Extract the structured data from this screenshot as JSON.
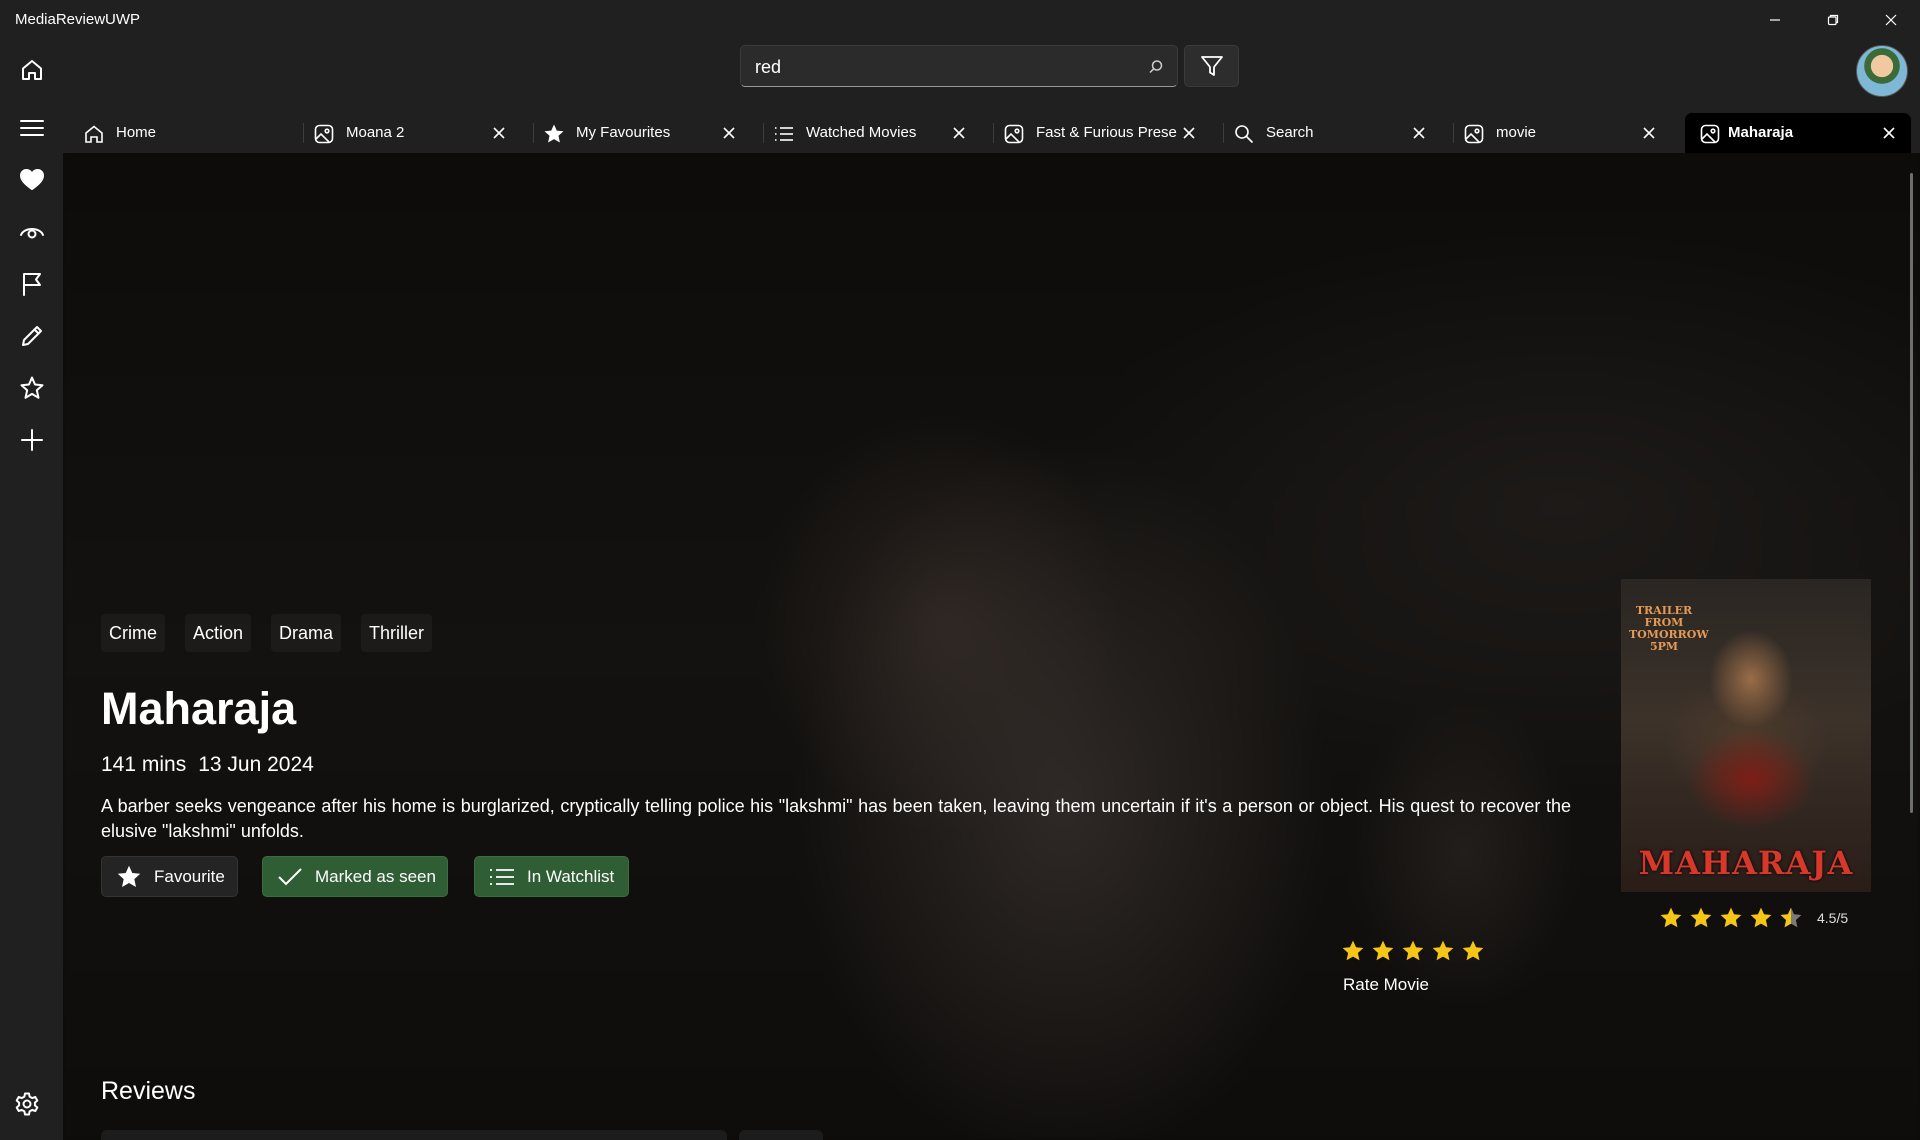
{
  "app": {
    "title": "MediaReviewUWP"
  },
  "window_controls": {
    "minimize_icon": "minimize-icon",
    "restore_icon": "restore-icon",
    "close_icon": "close-icon"
  },
  "search": {
    "value": "red",
    "placeholder": ""
  },
  "sidebar": {
    "items": [
      {
        "icon": "home-icon"
      },
      {
        "icon": "hamburger-menu-icon"
      },
      {
        "icon": "heart-icon"
      },
      {
        "icon": "eye-icon"
      },
      {
        "icon": "flag-icon"
      },
      {
        "icon": "pencil-icon"
      },
      {
        "icon": "star-outline-icon"
      },
      {
        "icon": "plus-icon"
      }
    ],
    "settings_icon": "gear-icon"
  },
  "tabs": [
    {
      "label": "Home",
      "icon": "home-icon",
      "closable": false
    },
    {
      "label": "Moana 2",
      "icon": "image-icon",
      "closable": true
    },
    {
      "label": "My Favourites",
      "icon": "star-icon",
      "closable": true
    },
    {
      "label": "Watched Movies",
      "icon": "list-icon",
      "closable": true
    },
    {
      "label": "Fast & Furious Prese",
      "icon": "image-icon",
      "closable": true
    },
    {
      "label": "Search",
      "icon": "search-icon",
      "closable": true
    },
    {
      "label": "movie",
      "icon": "image-icon",
      "closable": true
    },
    {
      "label": "Maharaja",
      "icon": "image-icon",
      "closable": true,
      "active": true
    }
  ],
  "movie": {
    "genres": [
      "Crime",
      "Action",
      "Drama",
      "Thriller"
    ],
    "title": "Maharaja",
    "runtime": "141 mins",
    "release_date": "13 Jun 2024",
    "overview": "A barber seeks vengeance after his home is burglarized, cryptically telling police his \"lakshmi\" has been taken, leaving them uncertain if it's a person or object. His quest to recover the elusive \"lakshmi\" unfolds.",
    "buttons": {
      "favourite": "Favourite",
      "seen": "Marked as seen",
      "watchlist": "In Watchlist"
    },
    "poster": {
      "tagline": "TRAILER FROM TOMORROW 5PM",
      "title": "MAHARAJA"
    },
    "rating": {
      "value": 4.5,
      "max": 5,
      "text": "4.5/5"
    },
    "user_rating": {
      "stars": 5,
      "label": "Rate Movie"
    }
  },
  "reviews": {
    "title": "Reviews"
  },
  "colors": {
    "accent_green": "#2f5d34",
    "star_yellow": "#f5c518",
    "background": "#202020"
  }
}
